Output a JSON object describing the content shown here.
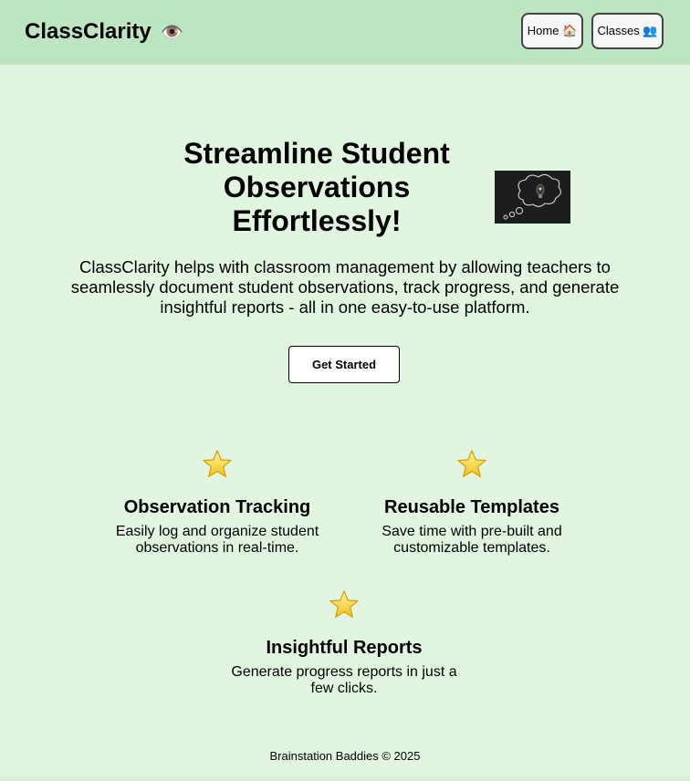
{
  "header": {
    "brand": "ClassClarity",
    "brand_icon": "👁️",
    "nav": [
      {
        "label": "Home 🏠"
      },
      {
        "label": "Classes 👥"
      }
    ],
    "background": "#bde5c2"
  },
  "hero": {
    "title": "Streamline Student Observations Effortlessly!",
    "image_icon": "lightbulb-thought-bubble",
    "description": "ClassClarity helps with classroom management by allowing teachers to seamlessly document student observations, track progress, and generate insightful reports - all in one easy-to-use platform.",
    "cta_label": "Get Started"
  },
  "features": [
    {
      "icon": "star-icon",
      "title": "Observation Tracking",
      "text": "Easily log and organize student observations in real-time."
    },
    {
      "icon": "star-icon",
      "title": "Reusable Templates",
      "text": "Save time with pre-built and customizable templates."
    },
    {
      "icon": "star-icon",
      "title": "Insightful Reports",
      "text": "Generate progress reports in just a few clicks."
    }
  ],
  "footer": {
    "text": "Brainstation Baddies © 2025"
  },
  "colors": {
    "page_background": "#e1f5e1",
    "header_background": "#bde5c2",
    "star_fill": "#f7d43b"
  }
}
